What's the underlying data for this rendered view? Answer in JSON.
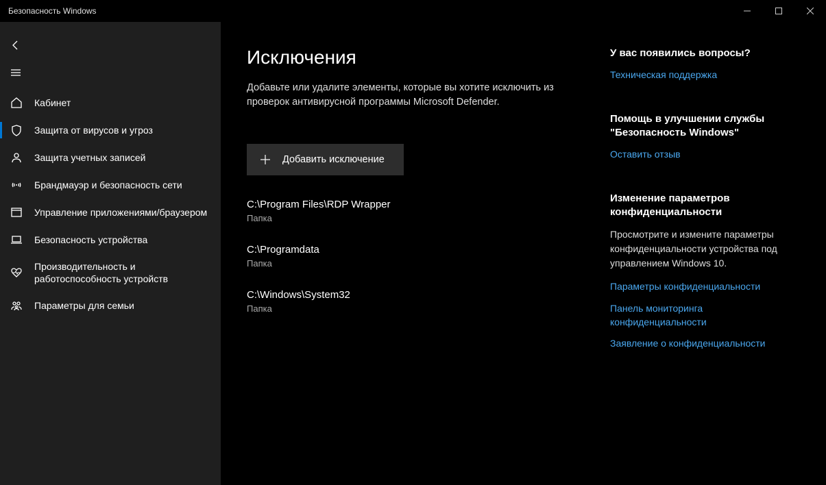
{
  "window": {
    "title": "Безопасность Windows"
  },
  "sidebar": {
    "items": [
      {
        "icon": "home",
        "label": "Кабинет"
      },
      {
        "icon": "shield",
        "label": "Защита от вирусов и угроз",
        "active": true
      },
      {
        "icon": "account",
        "label": "Защита учетных записей"
      },
      {
        "icon": "wifi",
        "label": "Брандмауэр и безопасность сети"
      },
      {
        "icon": "app",
        "label": "Управление приложениями/браузером"
      },
      {
        "icon": "device",
        "label": "Безопасность устройства"
      },
      {
        "icon": "heart",
        "label": "Производительность и работоспособность устройств"
      },
      {
        "icon": "family",
        "label": "Параметры для семьи"
      }
    ]
  },
  "main": {
    "title": "Исключения",
    "description": "Добавьте или удалите элементы, которые вы хотите исключить из проверок антивирусной программы Microsoft Defender.",
    "add_button": "Добавить исключение",
    "exclusions": [
      {
        "path": "C:\\Program Files\\RDP Wrapper",
        "type": "Папка"
      },
      {
        "path": "C:\\Programdata",
        "type": "Папка"
      },
      {
        "path": "C:\\Windows\\System32",
        "type": "Папка"
      }
    ]
  },
  "aside": {
    "sections": [
      {
        "title": "У вас появились вопросы?",
        "links": [
          "Техническая поддержка"
        ]
      },
      {
        "title": "Помощь в улучшении службы \"Безопасность Windows\"",
        "links": [
          "Оставить отзыв"
        ]
      },
      {
        "title": "Изменение параметров конфиденциальности",
        "text": "Просмотрите и измените параметры конфиденциальности устройства под управлением Windows 10.",
        "links": [
          "Параметры конфиденциальности",
          "Панель мониторинга конфиденциальности",
          "Заявление о конфиденциальности"
        ]
      }
    ]
  }
}
